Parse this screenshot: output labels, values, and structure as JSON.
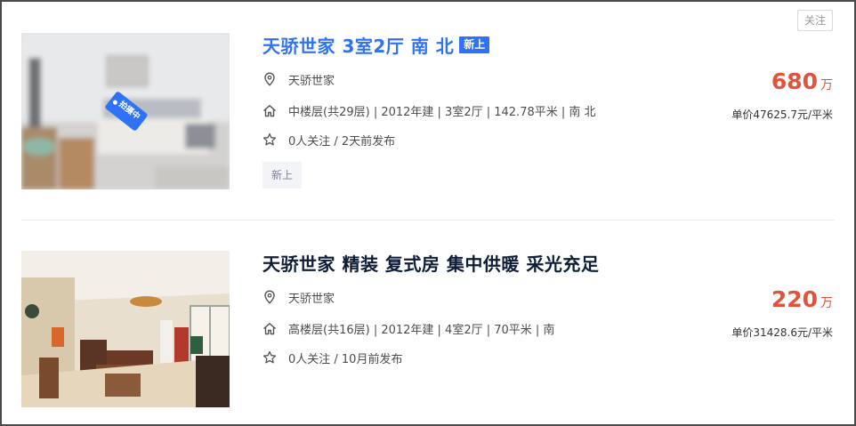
{
  "listings": [
    {
      "title": "天骄世家 3室2厅 南 北",
      "badge": "新上",
      "community": "天骄世家",
      "house_info": "中楼层(共29层) | 2012年建 | 3室2厅 | 142.78平米 | 南 北",
      "follow_info": "0人关注 / 2天前发布",
      "tag": "新上",
      "price": "680",
      "price_unit": "万",
      "unit_price": "单价47625.7元/平米",
      "photo_label": "拍摄中",
      "follow_button": "关注"
    },
    {
      "title": "天骄世家 精装 复式房 集中供暖 采光充足",
      "community": "天骄世家",
      "house_info": "高楼层(共16层) | 2012年建 | 4室2厅 | 70平米 | 南",
      "follow_info": "0人关注 / 10月前发布",
      "price": "220",
      "price_unit": "万",
      "unit_price": "单价31428.6元/平米"
    }
  ],
  "colors": {
    "title_link": "#3072f6",
    "title_dark": "#101d37",
    "price": "#e1533c",
    "badge_bg": "#3072f6"
  },
  "icons": [
    "location-pin-icon",
    "house-icon",
    "star-icon"
  ]
}
